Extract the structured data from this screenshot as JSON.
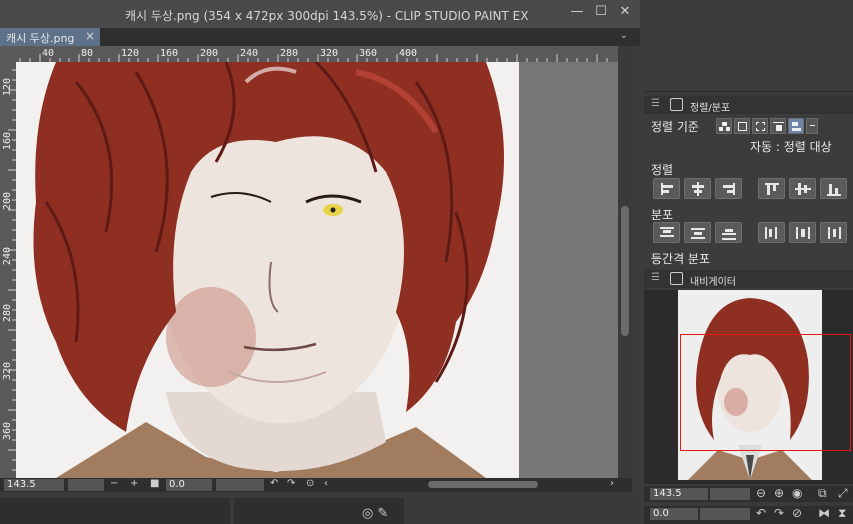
{
  "window": {
    "title": "캐시 두상.png (354 x 472px 300dpi 143.5%)  - CLIP STUDIO PAINT EX",
    "minimize": "—",
    "maximize": "☐",
    "close": "✕"
  },
  "tab": {
    "label": "캐시 두상.png",
    "close": "×",
    "overflow": "⌄"
  },
  "ruler": {
    "top": [
      "40",
      "80",
      "120",
      "160",
      "200",
      "240",
      "280",
      "320",
      "360",
      "400"
    ],
    "left": [
      "120",
      "160",
      "200",
      "240",
      "280",
      "320",
      "360"
    ]
  },
  "statusbar": {
    "zoom": "143.5",
    "minus": "−",
    "plus": "+",
    "angle": "0.0",
    "scroll_left": "‹",
    "scroll_right": "›"
  },
  "panel_align": {
    "title": "정렬/분포",
    "align_basis_label": "정렬 기준",
    "auto_target": "자동 : 정렬 대상",
    "align_label": "정렬",
    "distribute_label": "분포",
    "equal_spacing_label": "등간격 분포"
  },
  "panel_navigator": {
    "title": "내비게이터",
    "zoom": "143.5",
    "angle": "0.0"
  },
  "colors": {
    "hair": "#8e2f22",
    "hair_dark": "#5e1a14",
    "skin": "#e9dfd8",
    "coat": "#a27c5e",
    "view_frame": "#e01818",
    "tab_active": "#5d7289"
  }
}
